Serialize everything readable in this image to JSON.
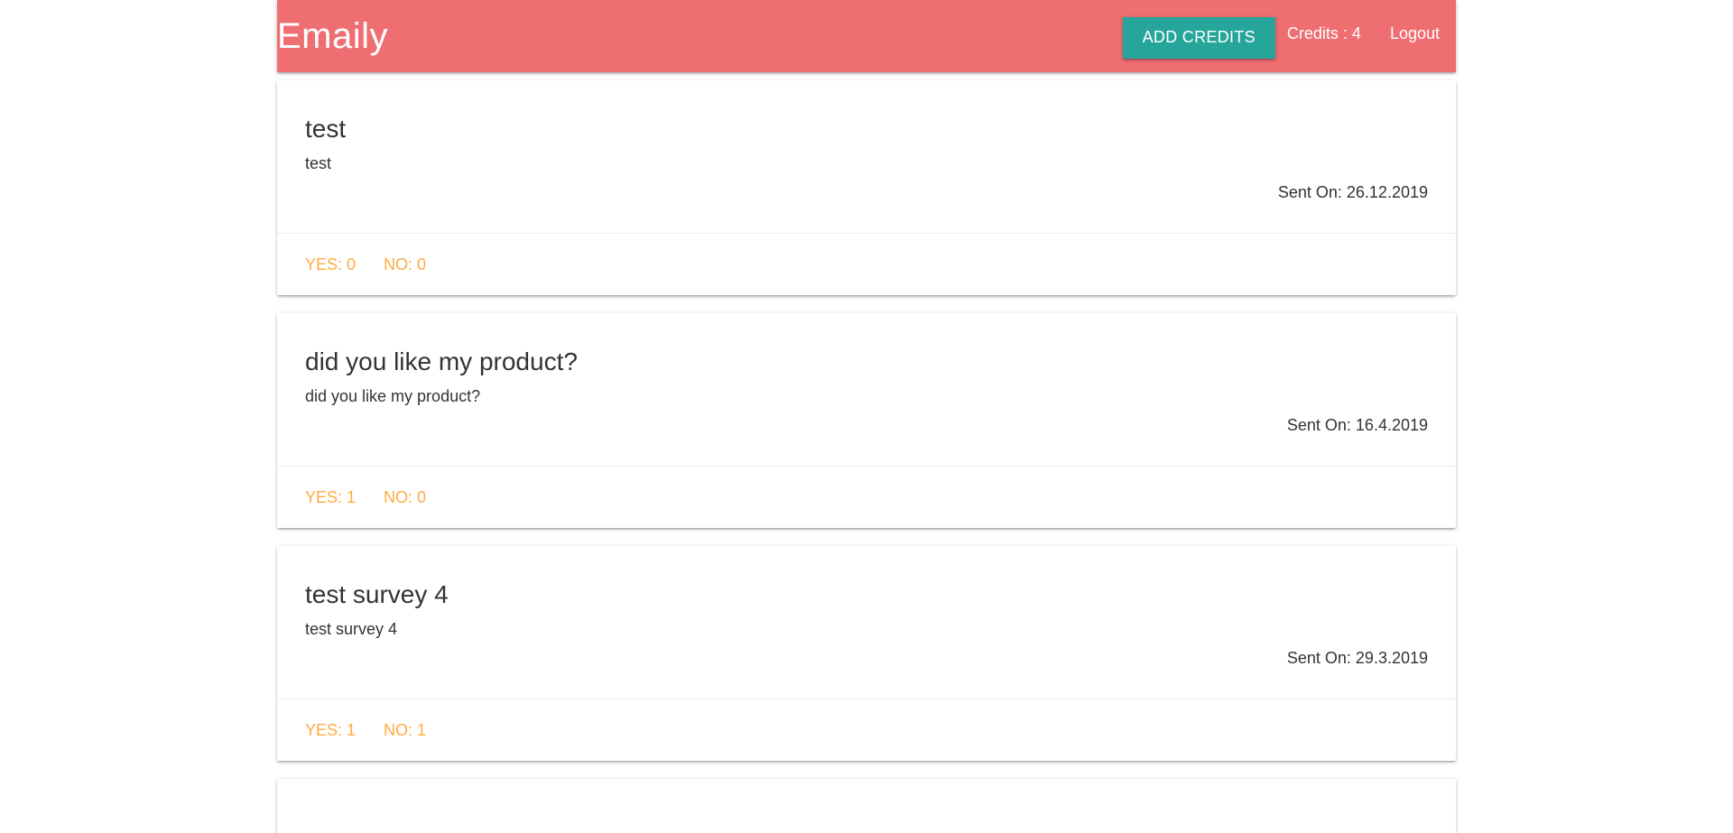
{
  "header": {
    "brand": "Emaily",
    "add_credits_label": "ADD CREDITS",
    "credits_text": "Credits : 4",
    "logout_label": "Logout"
  },
  "colors": {
    "header_bg": "#ef6e72",
    "button_bg": "#26a69a",
    "vote_text": "#ffab40"
  },
  "surveys": [
    {
      "title": "test",
      "body": "test",
      "date": "Sent On: 26.12.2019",
      "yes": "YES: 0",
      "no": "NO: 0"
    },
    {
      "title": "did you like my product?",
      "body": "did you like my product?",
      "date": "Sent On: 16.4.2019",
      "yes": "YES: 1",
      "no": "NO: 0"
    },
    {
      "title": "test survey 4",
      "body": "test survey 4",
      "date": "Sent On: 29.3.2019",
      "yes": "YES: 1",
      "no": "NO: 1"
    }
  ]
}
